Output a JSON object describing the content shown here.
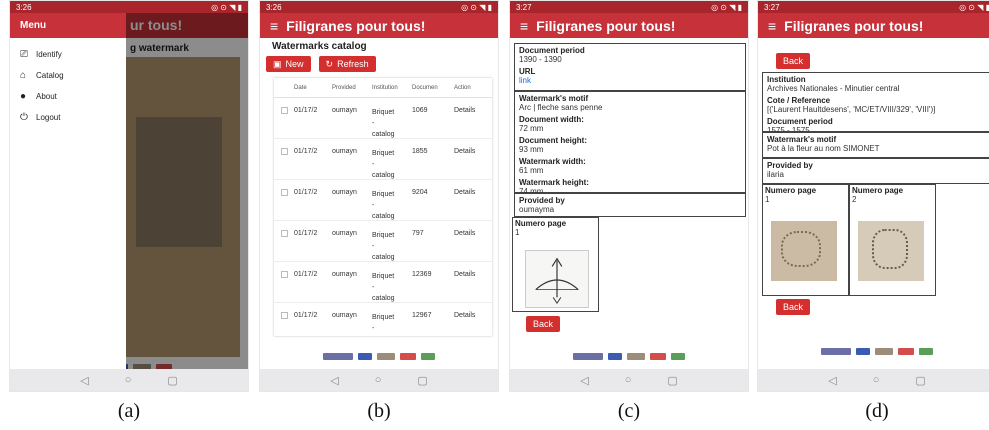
{
  "status": {
    "time_a": "3:26",
    "time_b": "3:26",
    "time_c": "3:27",
    "time_d": "3:27",
    "icons": "◎ ⊙ ◥ ▮"
  },
  "app_title": "Filigranes pour tous!",
  "panel_a": {
    "menu_title": "Menu",
    "header_partial": "ur tous!",
    "behind_title": "g watermark",
    "menu_items": [
      "Identify",
      "Catalog",
      "About",
      "Logout"
    ]
  },
  "panel_b": {
    "heading": "Watermarks catalog",
    "new_label": "New",
    "refresh_label": "Refresh",
    "columns": [
      "Date",
      "Provided",
      "Institution",
      "Documen",
      "Action"
    ],
    "rows": [
      {
        "date": "01/17/2",
        "provided": "oumayn",
        "institution": [
          "Briquet",
          "-",
          "catalog"
        ],
        "doc": "1069",
        "action": "Details"
      },
      {
        "date": "01/17/2",
        "provided": "oumayn",
        "institution": [
          "Briquet",
          "-",
          "catalog"
        ],
        "doc": "1855",
        "action": "Details"
      },
      {
        "date": "01/17/2",
        "provided": "oumayn",
        "institution": [
          "Briquet",
          "-",
          "catalog"
        ],
        "doc": "9204",
        "action": "Details"
      },
      {
        "date": "01/17/2",
        "provided": "oumayn",
        "institution": [
          "Briquet",
          "-",
          "catalog"
        ],
        "doc": "797",
        "action": "Details"
      },
      {
        "date": "01/17/2",
        "provided": "oumayn",
        "institution": [
          "Briquet",
          "-",
          "catalog"
        ],
        "doc": "12369",
        "action": "Details"
      },
      {
        "date": "01/17/2",
        "provided": "oumayn",
        "institution": [
          "Briquet",
          "-"
        ],
        "doc": "12967",
        "action": "Details"
      }
    ]
  },
  "panel_c": {
    "doc_period_label": "Document period",
    "doc_period": "1390 - 1390",
    "url_label": "URL",
    "url_value": "link",
    "motif_label": "Watermark's motif",
    "motif": "Arc | fleche sans penne",
    "doc_width_label": "Document width:",
    "doc_width": "72 mm",
    "doc_height_label": "Document height:",
    "doc_height": "93 mm",
    "wm_width_label": "Watermark width:",
    "wm_width": "61 mm",
    "wm_height_label": "Watermark height:",
    "wm_height": "74 mm",
    "provided_label": "Provided by",
    "provided": "oumayma",
    "page_label": "Numero page",
    "page_num": "1",
    "back_label": "Back"
  },
  "panel_d": {
    "back_label": "Back",
    "institution_label": "Institution",
    "institution": "Archives Nationales - Minutier central",
    "cote_label": "Cote / Reference",
    "cote": "[('Laurent Haultdesens', 'MC/ET/VIII/329', 'VIII')]",
    "doc_period_label": "Document period",
    "doc_period": "1575 - 1575",
    "motif_label": "Watermark's motif",
    "motif": "Pot à la fleur au nom SIMONET",
    "provided_label": "Provided by",
    "provided": "ilaria",
    "page_label_1": "Numero page",
    "page_num_1": "1",
    "page_label_2": "Numero page",
    "page_num_2": "2",
    "back_label_2": "Back"
  },
  "logos": [
    "PSL",
    "IRHT"
  ],
  "captions": [
    "(a)",
    "(b)",
    "(c)",
    "(d)"
  ],
  "colors": {
    "brand_red": "#c6313a",
    "status_red": "#a8262b",
    "button_red": "#d32f2f"
  }
}
